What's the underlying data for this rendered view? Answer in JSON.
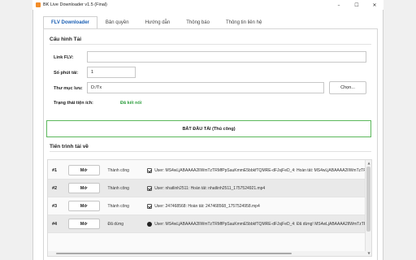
{
  "window": {
    "title": "BK Live Downloader v1.5 (Final)",
    "minimize": "–",
    "maximize": "☐",
    "close": "✕"
  },
  "tabs": [
    {
      "label": "FLV Downloader",
      "active": true
    },
    {
      "label": "Bản quyền"
    },
    {
      "label": "Hướng dẫn"
    },
    {
      "label": "Thông báo"
    },
    {
      "label": "Thông tin liên hệ"
    }
  ],
  "config": {
    "section_title": "Cấu hình Tải",
    "link_label": "Link FLV:",
    "link_value": "",
    "minutes_label": "Số phút tải:",
    "minutes_value": "1",
    "folder_label": "Thư mục lưu:",
    "folder_value": "D:/Tx",
    "choose_button": "Chọn...",
    "ext_label": "Trạng thái tiện ích:",
    "ext_status": "Đã kết nối",
    "status_color": "#2e9e3e"
  },
  "start_button": "BẮT ĐẦU TẢI (Thủ công)",
  "progress": {
    "section_title": "Tiến trình tải về",
    "rows": [
      {
        "num": "#1",
        "button": "Mở",
        "state": "Thành công",
        "icon": "check-icon",
        "message": "User: MS4wLjABAAAA2lIWmTzTRMfPpSauKmmE5bbkfTQMRE-dFJsjFeD_4: Hoàn tất: MS4wLjABAAAA2lIWmTzTRMfPpSau"
      },
      {
        "num": "#2",
        "button": "Mở",
        "state": "Thành công",
        "icon": "check-icon",
        "message": "User: nhatlinh2511: Hoàn tất: nhatlinh2511_1757524921.mp4"
      },
      {
        "num": "#3",
        "button": "Mở",
        "state": "Thành công",
        "icon": "check-icon",
        "message": "User: 247468568: Hoàn tất: 247468568_1757524958.mp4"
      },
      {
        "num": "#4",
        "button": "Mở",
        "state": "Đã dừng",
        "icon": "stop-dot-icon",
        "message": "User: MS4wLjABAAAA2lIWmTzTRMfPpSauKmmE5bbkfTQMRE-dFJsjFeD_4: Đã dừng! MS4wLjABAAAA2lIWmTzTRMfPpSau"
      }
    ]
  },
  "colors": {
    "accent": "#1a5fb4",
    "start_border": "#5cb85c",
    "app_icon": "#f28c28"
  }
}
